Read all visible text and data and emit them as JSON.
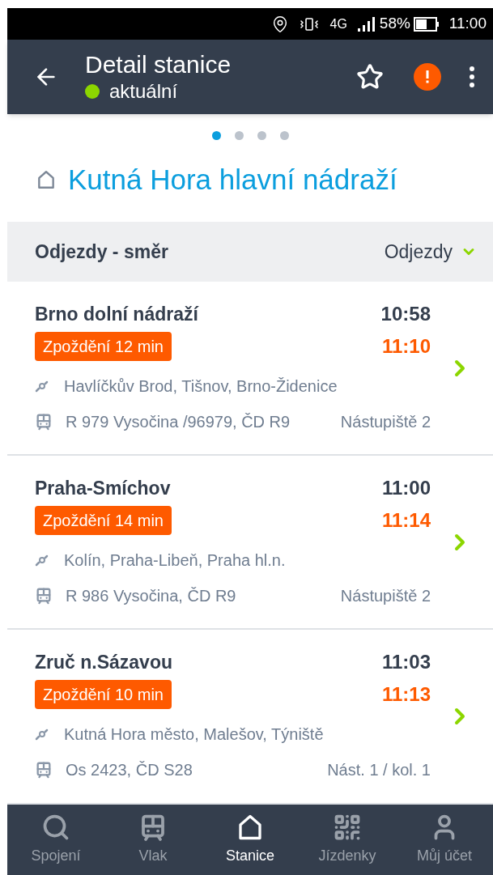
{
  "status_bar": {
    "network": "4G",
    "battery": "58%",
    "time": "11:00"
  },
  "app_bar": {
    "title": "Detail stanice",
    "status": {
      "label": "aktuální",
      "color": "#8cd600"
    }
  },
  "pager": [
    {
      "selected": true
    },
    {
      "selected": false
    },
    {
      "selected": false
    },
    {
      "selected": false
    }
  ],
  "station": "Kutná Hora hlavní nádraží",
  "section": {
    "title": "Odjezdy - směr",
    "dropdown": "Odjezdy"
  },
  "departures": [
    {
      "destination": "Brno dolní nádraží",
      "scheduled": "10:58",
      "delay": "Zpoždění 12 min",
      "actual": "11:10",
      "via": "Havlíčkův Brod, Tišnov, Brno-Židenice",
      "train": "R 979 Vysočina /96979, ČD R9",
      "platform": "Nástupiště 2"
    },
    {
      "destination": "Praha-Smíchov",
      "scheduled": "11:00",
      "delay": "Zpoždění 14 min",
      "actual": "11:14",
      "via": "Kolín, Praha-Libeň, Praha hl.n.",
      "train": "R 986 Vysočina, ČD R9",
      "platform": "Nástupiště 2"
    },
    {
      "destination": "Zruč n.Sázavou",
      "scheduled": "11:03",
      "delay": "Zpoždění 10 min",
      "actual": "11:13",
      "via": "Kutná Hora město, Malešov, Týniště",
      "train": "Os 2423, ČD S28",
      "platform": "Nást. 1 / kol. 1"
    }
  ],
  "bottom_nav": [
    {
      "kind": "search",
      "label": "Spojení",
      "selected": false
    },
    {
      "kind": "train",
      "label": "Vlak",
      "selected": false
    },
    {
      "kind": "station",
      "label": "Stanice",
      "selected": true
    },
    {
      "kind": "tickets",
      "label": "Jízdenky",
      "selected": false
    },
    {
      "kind": "account",
      "label": "Můj účet",
      "selected": false
    }
  ]
}
